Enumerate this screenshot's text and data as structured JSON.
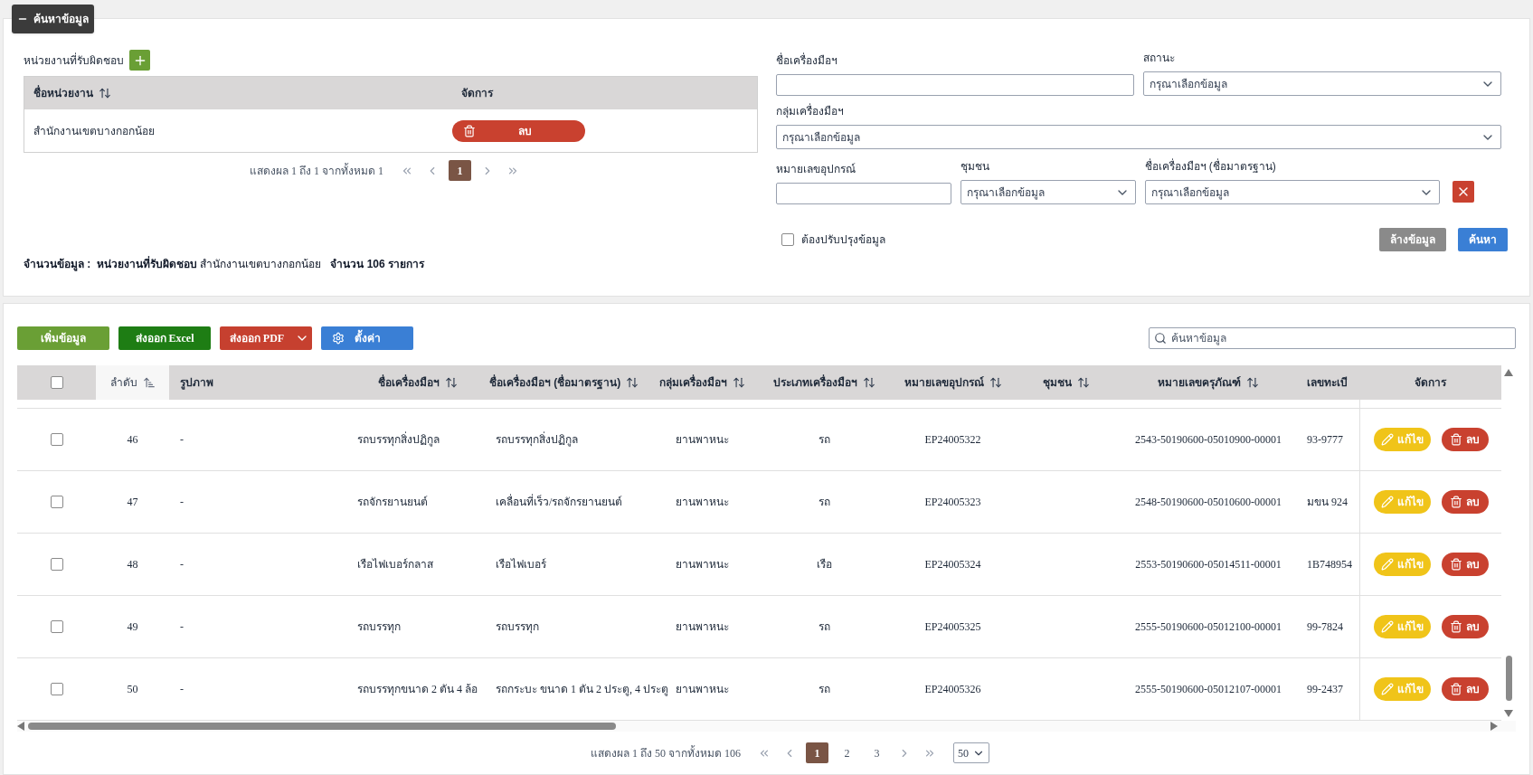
{
  "search_panel": {
    "toggle_label": "ค้นหาข้อมูล",
    "expanded": true
  },
  "responsible_units": {
    "label": "หน่วยงานที่รับผิดชอบ",
    "columns": [
      {
        "label": "ชื่อหน่วยงาน",
        "sortable": true
      },
      {
        "label": "จัดการ",
        "sortable": false
      }
    ],
    "rows": [
      {
        "name": "สำนักงานเขตบางกอกน้อย",
        "delete_label": "ลบ"
      }
    ],
    "pagination": {
      "summary": "แสดงผล 1 ถึง 1 จากทั้งหมด 1",
      "pages": [
        {
          "label": "1",
          "selected": true
        }
      ]
    }
  },
  "filters": [
    {
      "kind": "text",
      "label": "ชื่อเครื่องมือฯ"
    },
    {
      "kind": "select",
      "label": "สถานะ",
      "placeholder": "กรุณาเลือกข้อมูล"
    },
    {
      "kind": "select",
      "label": "กลุ่มเครื่องมือฯ",
      "placeholder": "กรุณาเลือกข้อมูล"
    },
    {
      "kind": "text",
      "label": "หมายเลขอุปกรณ์"
    },
    {
      "kind": "select",
      "label": "ชุมชน",
      "placeholder": "กรุณาเลือกข้อมูล"
    },
    {
      "kind": "select",
      "label": "ชื่อเครื่องมือฯ (ชื่อมาตรฐาน)",
      "placeholder": "กรุณาเลือกข้อมูล"
    }
  ],
  "needs_update": {
    "label": "ต้องปรับปรุงข้อมูล",
    "checked": false
  },
  "form_buttons": {
    "clear": "ล้างข้อมูล",
    "search": "ค้นหา"
  },
  "summary": "**จำนวนข้อมูล :  หน่วยงานที่รับผิดชอบ** สำนักงานเขตบางกอกน้อย   **จำนวน 106 รายการ**",
  "toolbar": [
    {
      "kind": "add",
      "label": "เพิ่มข้อมูล"
    },
    {
      "kind": "excel",
      "label": "ส่งออก Excel"
    },
    {
      "kind": "pdf",
      "label": "ส่งออก PDF"
    },
    {
      "kind": "settings",
      "label": "ตั้งค่า"
    }
  ],
  "table_search": {
    "placeholder": "ค้นหาข้อมูล"
  },
  "table": {
    "select_all": {
      "checked": false
    },
    "columns": [
      {
        "label": "ลำดับ",
        "sortable": true,
        "selected": true
      },
      {
        "label": "รูปภาพ",
        "sortable": false,
        "selected": false
      },
      {
        "label": "ชื่อเครื่องมือฯ",
        "sortable": true,
        "selected": false
      },
      {
        "label": "ชื่อเครื่องมือฯ (ชื่อมาตรฐาน)",
        "sortable": true,
        "selected": false
      },
      {
        "label": "กลุ่มเครื่องมือฯ",
        "sortable": true,
        "selected": false
      },
      {
        "label": "ประเภทเครื่องมือฯ",
        "sortable": true,
        "selected": false
      },
      {
        "label": "หมายเลขอุปกรณ์",
        "sortable": true,
        "selected": false
      },
      {
        "label": "ชุมชน",
        "sortable": true,
        "selected": false
      },
      {
        "label": "หมายเลขครุภัณฑ์",
        "sortable": true,
        "selected": false
      },
      {
        "label": "เลขทะเบี",
        "sortable": false,
        "selected": false
      }
    ],
    "actions_label": "จัดการ",
    "rows": [
      {
        "checked": false,
        "no": "46",
        "image": "-",
        "name": "รถบรรทุกสิ่งปฏิกูล",
        "std_name": "รถบรรทุกสิ่งปฏิกูล",
        "group": "ยานพาหนะ",
        "type": "รถ",
        "equipment_no": "EP24005322",
        "asset_no": "2543-50190600-05010900-00001",
        "registration": "93-9777",
        "edit_label": "แก้ไข",
        "delete_label": "ลบ"
      },
      {
        "checked": false,
        "no": "47",
        "image": "-",
        "name": "รถจักรยานยนต์",
        "std_name": "เคลื่อนที่เร็ว/รถจักรยานยนต์",
        "group": "ยานพาหนะ",
        "type": "รถ",
        "equipment_no": "EP24005323",
        "asset_no": "2548-50190600-05010600-00001",
        "registration": "มขน 924",
        "edit_label": "แก้ไข",
        "delete_label": "ลบ"
      },
      {
        "checked": false,
        "no": "48",
        "image": "-",
        "name": "เรือไฟเบอร์กลาส",
        "std_name": "เรือไฟเบอร์",
        "group": "ยานพาหนะ",
        "type": "เรือ",
        "equipment_no": "EP24005324",
        "asset_no": "2553-50190600-05014511-00001",
        "registration": "1B748954",
        "edit_label": "แก้ไข",
        "delete_label": "ลบ"
      },
      {
        "checked": false,
        "no": "49",
        "image": "-",
        "name": "รถบรรทุก",
        "std_name": "รถบรรทุก",
        "group": "ยานพาหนะ",
        "type": "รถ",
        "equipment_no": "EP24005325",
        "asset_no": "2555-50190600-05012100-00001",
        "registration": "99-7824",
        "edit_label": "แก้ไข",
        "delete_label": "ลบ"
      },
      {
        "checked": false,
        "no": "50",
        "image": "-",
        "name": "รถบรรทุกขนาด 2 ตัน 4 ล้อ",
        "std_name": "รถกระบะ ขนาด 1 ตัน 2 ประตู, 4 ประตู",
        "group": "ยานพาหนะ",
        "type": "รถ",
        "equipment_no": "EP24005326",
        "asset_no": "2555-50190600-05012107-00001",
        "registration": "99-2437",
        "edit_label": "แก้ไข",
        "delete_label": "ลบ"
      }
    ]
  },
  "pagination": {
    "summary": "แสดงผล 1 ถึง 50 จากทั้งหมด 106",
    "pages": [
      {
        "label": "1",
        "selected": true
      },
      {
        "label": "2",
        "selected": false
      },
      {
        "label": "3",
        "selected": false
      }
    ],
    "page_size": "50"
  }
}
